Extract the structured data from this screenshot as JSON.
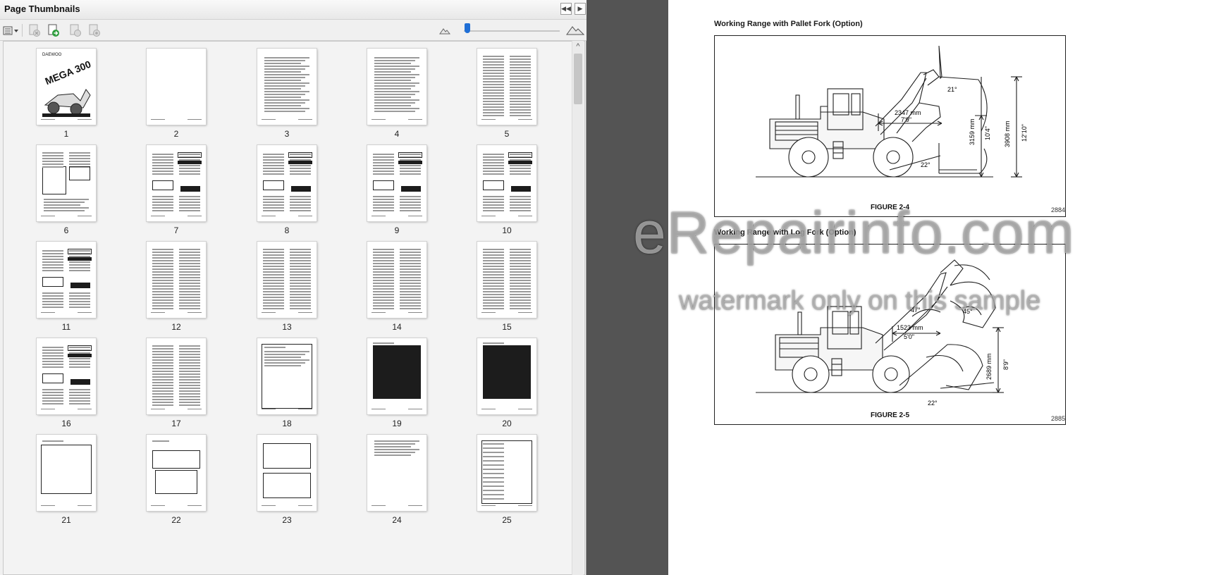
{
  "panel": {
    "title": "Page Thumbnails",
    "collapse_label": "◀◀",
    "next_label": "▶",
    "scroll_up": "^"
  },
  "toolbar": {
    "icons": [
      "options-menu-icon",
      "delete-pages-icon",
      "insert-pages-icon",
      "extract-pages-icon",
      "print-pages-icon",
      "zoom-out-mountains-icon",
      "zoom-in-mountains-icon"
    ]
  },
  "thumbnails": [
    {
      "page": "1"
    },
    {
      "page": "2"
    },
    {
      "page": "3"
    },
    {
      "page": "4"
    },
    {
      "page": "5"
    },
    {
      "page": "6"
    },
    {
      "page": "7"
    },
    {
      "page": "8"
    },
    {
      "page": "9"
    },
    {
      "page": "10"
    },
    {
      "page": "11"
    },
    {
      "page": "12"
    },
    {
      "page": "13"
    },
    {
      "page": "14"
    },
    {
      "page": "15"
    },
    {
      "page": "16"
    },
    {
      "page": "17"
    },
    {
      "page": "18"
    },
    {
      "page": "19"
    },
    {
      "page": "20"
    },
    {
      "page": "21"
    },
    {
      "page": "22"
    },
    {
      "page": "23"
    },
    {
      "page": "24"
    },
    {
      "page": "25"
    }
  ],
  "cover": {
    "brand": "DAEWOO",
    "model": "MEGA 300"
  },
  "document": {
    "figure1": {
      "heading": "Working Range with Pallet Fork (Option)",
      "caption": "FIGURE 2-4",
      "number": "2884",
      "dims": {
        "reach_mm": "2347 mm",
        "reach_ft": "7'9\"",
        "height_mm": "3159 mm",
        "height_ft": "10'4\"",
        "max_mm": "3908 mm",
        "max_ft": "12'10\"",
        "angle_top": "21°",
        "angle_bottom": "22°"
      }
    },
    "figure2": {
      "heading": "Working Range with Log Fork (Option)",
      "caption": "FIGURE 2-5",
      "number": "2885",
      "dims": {
        "reach_mm": "1523 mm",
        "reach_ft": "5'0\"",
        "height_mm": "2689 mm",
        "height_ft": "8'9\"",
        "angle_a": "47°",
        "angle_b": "45°",
        "angle_bottom": "22°"
      }
    }
  },
  "watermark": {
    "main": "eRepairinfo.com",
    "sub": "watermark only on this sample"
  }
}
